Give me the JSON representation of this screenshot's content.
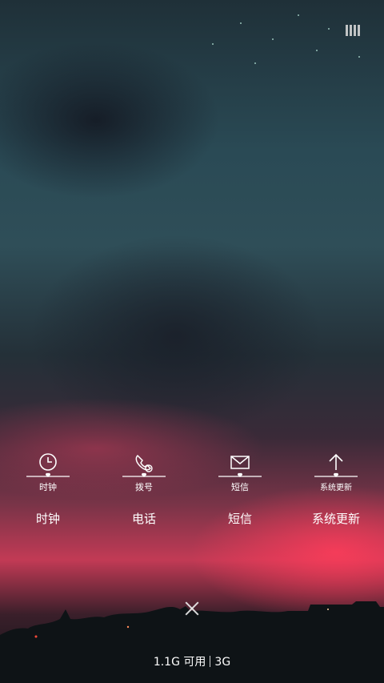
{
  "apps": [
    {
      "label": "时钟",
      "icon": "clock-icon",
      "badge": "时钟"
    },
    {
      "label": "电话",
      "icon": "phone-icon",
      "badge": "拨号"
    },
    {
      "label": "短信",
      "icon": "mail-icon",
      "badge": "短信"
    },
    {
      "label": "系统更新",
      "icon": "upload-arrow-icon",
      "badge": "系统更新"
    }
  ],
  "status": {
    "memory": "1.1G 可用",
    "network": "3G"
  },
  "colors": {
    "sky_top": "#1f3038",
    "sunset_red": "#c23a55",
    "text": "#ffffff"
  }
}
